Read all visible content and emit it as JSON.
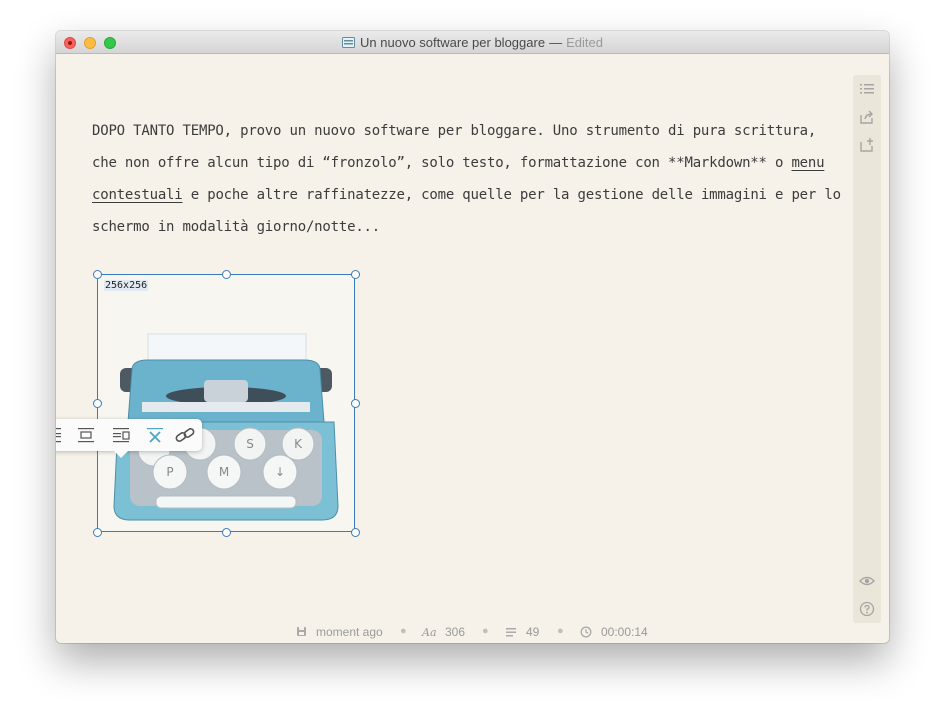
{
  "window": {
    "title": "Un nuovo software per bloggare",
    "separator": "—",
    "edited": "Edited"
  },
  "content": {
    "p1_before": "DOPO TANTO TEMPO, provo un nuovo software per bloggare. Uno strumento di pura scrittura, che non offre alcun tipo di “fronzolo”, solo testo, formattazione con **Markdown** o ",
    "p1_link": "menu contestuali",
    "p1_after": " e poche altre raffinatezze, come quelle per la gestione delle immagini e per lo schermo in modalità giorno/notte..."
  },
  "image": {
    "size_label": "256x256",
    "keys": [
      "S",
      "K",
      "P",
      "M",
      "↓"
    ]
  },
  "image_toolbar": {
    "items": [
      "align-left-icon",
      "align-center-icon",
      "align-right-icon",
      "remove-icon",
      "link-icon"
    ]
  },
  "sidebar": {
    "icons": [
      "outline-list-icon",
      "share-icon",
      "export-icon",
      "eye-icon",
      "help-icon"
    ]
  },
  "status": {
    "saved": "moment ago",
    "chars_label": "Aa",
    "chars": "306",
    "words": "49",
    "time": "00:00:14"
  },
  "colors": {
    "accent": "#3b7bb5",
    "background": "#f6f2e9",
    "toolbar_active": "#4ba5c5"
  }
}
